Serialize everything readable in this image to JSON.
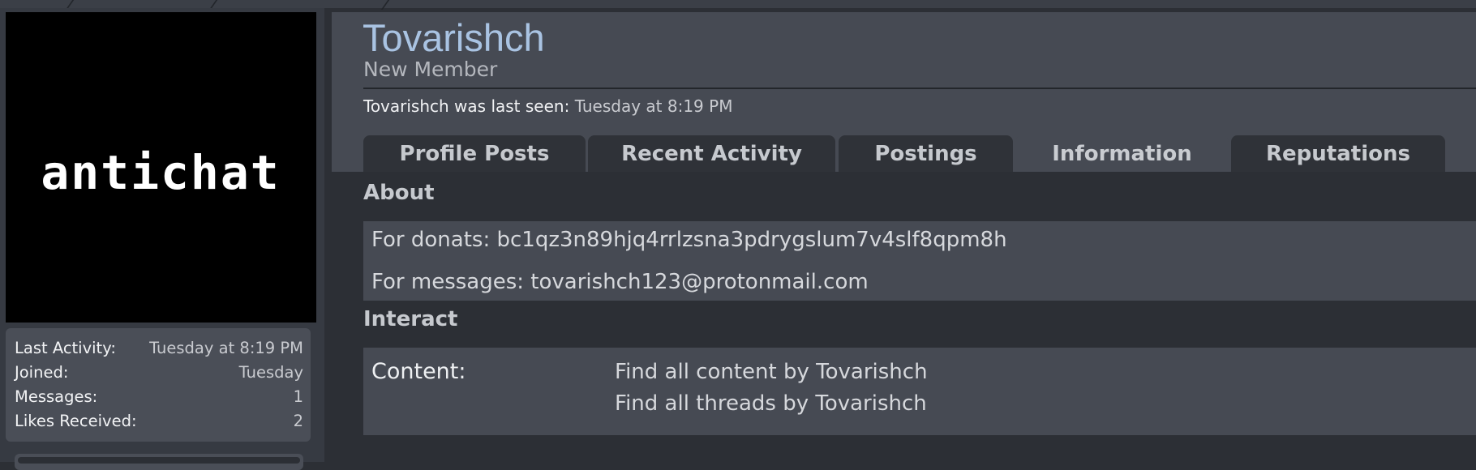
{
  "profile": {
    "username": "Tovarishch",
    "user_title": "New Member",
    "last_seen_label": "Tovarishch was last seen:",
    "last_seen_value": "Tuesday at 8:19 PM",
    "avatar_text": "antichat"
  },
  "sidebar": {
    "stats": [
      {
        "label": "Last Activity:",
        "value": "Tuesday at 8:19 PM"
      },
      {
        "label": "Joined:",
        "value": "Tuesday"
      },
      {
        "label": "Messages:",
        "value": "1"
      },
      {
        "label": "Likes Received:",
        "value": "2"
      }
    ]
  },
  "tabs": [
    {
      "label": "Profile Posts",
      "active": false
    },
    {
      "label": "Recent Activity",
      "active": false
    },
    {
      "label": "Postings",
      "active": false
    },
    {
      "label": "Information",
      "active": true
    },
    {
      "label": "Reputations",
      "active": false
    }
  ],
  "about": {
    "heading": "About",
    "lines": [
      "For donats: bc1qz3n89hjq4rrlzsna3pdrygslum7v4slf8qpm8h",
      "For messages: tovarishch123@protonmail.com"
    ]
  },
  "interact": {
    "heading": "Interact",
    "content_label": "Content:",
    "links": [
      "Find all content by Tovarishch",
      "Find all threads by Tovarishch"
    ]
  },
  "colors": {
    "username": "#a9c3e2",
    "panel": "#464a53",
    "page_bg": "#2c2f35"
  }
}
